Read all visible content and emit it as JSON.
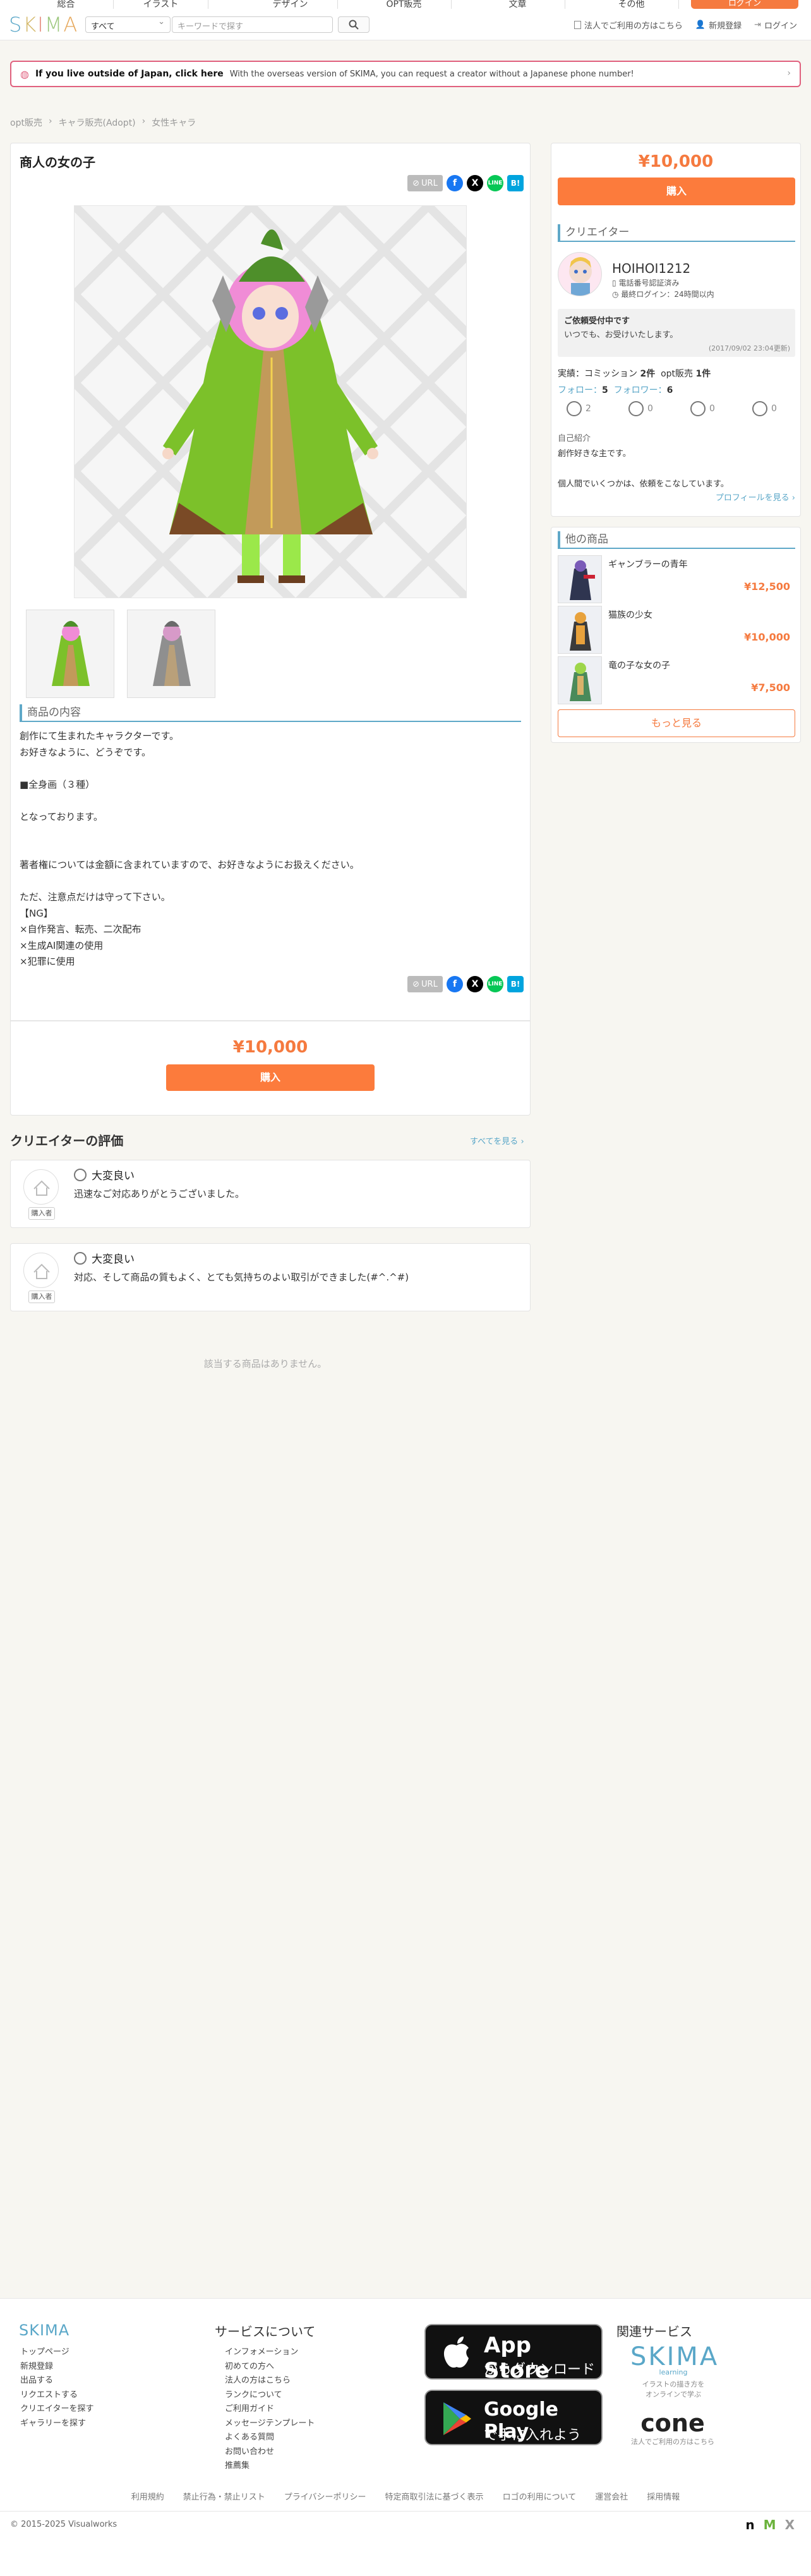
{
  "topnav": {
    "tabs": [
      "総合",
      "イラスト",
      "デザイン",
      "OPT販売",
      "文章",
      "その他"
    ],
    "register_btn": "ログイン"
  },
  "header": {
    "logo": "SKIMA",
    "category": "すべて",
    "search_placeholder": "キーワードで探す",
    "links": {
      "corp": "法人でご利用の方はこちら",
      "signup": "新規登録",
      "login": "ログイン"
    }
  },
  "banner": {
    "bold": "If you live outside of Japan, click here",
    "msg": "With the overseas version of SKIMA, you can request a creator without a Japanese phone number!"
  },
  "breadcrumb": [
    "opt販売",
    "キャラ販売(Adopt)",
    "女性キャラ"
  ],
  "product": {
    "title": "商人の女の子",
    "url_label": "URL",
    "section_heading": "商品の内容",
    "description": "創作にて生まれたキャラクターです。\nお好きなように、どうぞです。\n\n■全身画（３種）\n\nとなっております。\n\n\n著者権については金額に含まれていますので、お好きなようにお扱えください。\n\nただ、注意点だけは守って下さい。\n【NG】\n×自作発言、転売、二次配布\n×生成AI関連の使用\n×犯罪に使用",
    "price": "¥10,000",
    "buy_label": "購入"
  },
  "sidebar": {
    "price": "¥10,000",
    "buy_label": "購入",
    "creator_heading": "クリエイター",
    "creator_name": "HOIHOI1212",
    "phone_verified": "電話番号認証済み",
    "last_login": "最終ログイン：24時間以内",
    "accepting_title": "ご依頼受付中です",
    "accepting_body": "いつでも、お受けいたします。",
    "accepting_date": "(2017/09/02 23:04更新)",
    "results_label": "実績：",
    "commission_label": "コミッション",
    "commission_count": "2件",
    "opt_label": "opt販売",
    "opt_count": "1件",
    "follow_label": "フォロー：",
    "follow_count": "5",
    "follower_label": "フォロワー：",
    "follower_count": "6",
    "ratings": [
      "2",
      "0",
      "0",
      "0"
    ],
    "intro_heading": "自己紹介",
    "intro_1": "創作好きな主です。",
    "intro_2": "個人間でいくつかは、依頼をこなしています。",
    "profile_link": "プロフィールを見る ›",
    "other_heading": "他の商品",
    "others": [
      {
        "name": "ギャンブラーの青年",
        "price": "¥12,500"
      },
      {
        "name": "猫族の少女",
        "price": "¥10,000"
      },
      {
        "name": "竜の子な女の子",
        "price": "¥7,500"
      }
    ],
    "more_label": "もっと見る"
  },
  "reviews": {
    "title": "クリエイターの評価",
    "see_all": "すべてを見る ›",
    "items": [
      {
        "rating": "大変良い",
        "body": "迅速なご対応ありがとうございました。",
        "tag": "購入者"
      },
      {
        "rating": "大変良い",
        "body": "対応、そして商品の質もよく、とても気持ちのよい取引ができました(#^.^#)",
        "tag": "購入者"
      }
    ],
    "no_items": "該当する商品はありません。"
  },
  "footer": {
    "logo": "SKIMA",
    "col1": [
      "トップページ",
      "新規登録",
      "出品する",
      "リクエストする",
      "クリエイターを探す",
      "ギャラリーを探す"
    ],
    "service_heading": "サービスについて",
    "col2": [
      "インフォメーション",
      "初めての方へ",
      "法人の方はこちら",
      "ランクについて",
      "ご利用ガイド",
      "メッセージテンプレート",
      "よくある質問",
      "お問い合わせ",
      "推薦集"
    ],
    "appstore_l1": "App Store",
    "appstore_l2": "からダウンロード",
    "gplay_l1": "Google Play",
    "gplay_l2": "で手に入れよう",
    "related_heading": "関連サービス",
    "learning_logo": "SKIMA",
    "learning_sub": "learning",
    "learning_desc1": "イラストの描き方を",
    "learning_desc2": "オンラインで学ぶ",
    "cone_logo": "cone",
    "cone_desc": "法人でご利用の方はこちら",
    "links": [
      "利用規約",
      "禁止行為・禁止リスト",
      "プライバシーポリシー",
      "特定商取引法に基づく表示",
      "ロゴの利用について",
      "運営会社",
      "採用情報"
    ],
    "copyright": "© 2015-2025 Visualworks"
  },
  "colors": {
    "accent": "#fc7b3c",
    "brand": "#5aa7c8",
    "banner_border": "#e0607e"
  }
}
